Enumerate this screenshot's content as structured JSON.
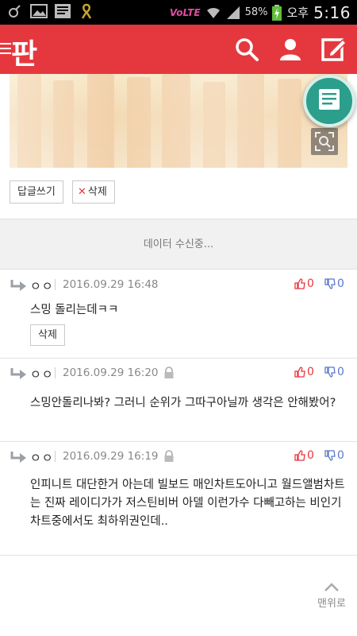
{
  "status_bar": {
    "icons": [
      "person-icon",
      "gallery-icon",
      "news-icon",
      "ribbon-icon"
    ],
    "network": "VoLTE",
    "battery": "58%",
    "ampm": "오후",
    "time": "5:16"
  },
  "header": {
    "logo": "판",
    "icons": [
      "search-icon",
      "user-icon",
      "write-icon"
    ],
    "color": "#e5383e"
  },
  "post_actions": {
    "reply_label": "답글쓰기",
    "delete_label": "삭제"
  },
  "loading_text": "데이터 수신중...",
  "comments": [
    {
      "name": "ㅇㅇ",
      "date": "2016.09.29 16:48",
      "locked": false,
      "up": "0",
      "down": "0",
      "text": "스밍 돌리는데ㅋㅋ",
      "delete_label": "삭제"
    },
    {
      "name": "ㅇㅇ",
      "date": "2016.09.29 16:20",
      "locked": true,
      "up": "0",
      "down": "0",
      "text": "스밍안돌리나봐? 그러니 순위가 그따구아닐까 생각은 안해봤어?"
    },
    {
      "name": "ㅇㅇ",
      "date": "2016.09.29 16:19",
      "locked": true,
      "up": "0",
      "down": "0",
      "text": "인피니트 대단한거 아는데 빌보드 매인차트도아니고 월드앨범차트는 진짜 레이디가가 저스틴비버 아델 이런가수 다빼고하는 비인기차트중에서도 최하위권인데.."
    }
  ],
  "back_to_top": "맨위로"
}
